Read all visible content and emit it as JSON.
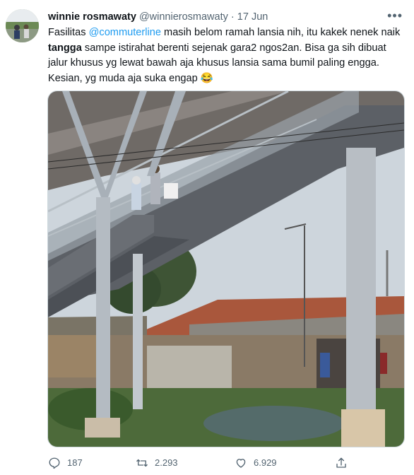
{
  "tweet": {
    "author_name": "winnie rosmawaty",
    "author_handle": "@winnierosmawaty",
    "separator": "·",
    "date": "17 Jun",
    "more_label": "•••",
    "text_part1": "Fasilitas ",
    "mention": "@commuterline",
    "text_part2": " masih belom ramah lansia nih, itu kakek nenek naik ",
    "bold_word": "tangga",
    "text_part3": " sampe istirahat berenti sejenak gara2 ngos2an. Bisa ga sih dibuat jalur khusus yg lewat bawah aja khusus lansia sama bumil paling engga. Kesian, yg muda aja suka engap ",
    "emoji": "😂"
  },
  "actions": {
    "replies": "187",
    "retweets": "2.293",
    "likes": "6.929"
  },
  "icons": {
    "reply": "reply-icon",
    "retweet": "retweet-icon",
    "like": "heart-icon",
    "share": "share-icon",
    "more": "more-icon"
  },
  "colors": {
    "link": "#1d9bf0",
    "secondary_text": "#536471"
  }
}
